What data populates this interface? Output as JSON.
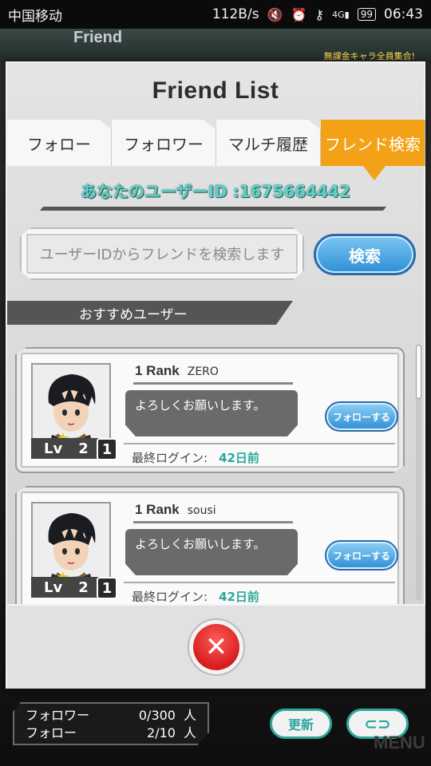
{
  "status_bar": {
    "carrier": "中国移动",
    "net_speed": "112B/s",
    "battery": "99",
    "time": "06:43",
    "signal": "4G"
  },
  "background": {
    "header_title": "Friend",
    "banner": "無課金キャラ全員集合!"
  },
  "modal": {
    "title": "Friend List",
    "tabs": [
      {
        "label": "フォロー",
        "active": false
      },
      {
        "label": "フォロワー",
        "active": false
      },
      {
        "label": "マルチ履歴",
        "active": false
      },
      {
        "label": "フレンド検索",
        "active": true
      }
    ],
    "user_id_text": "あなたのユーザーID :1675664442",
    "search": {
      "placeholder": "ユーザーIDからフレンドを検索します",
      "button_label": "検索"
    },
    "section_title": "おすすめユーザー",
    "users": [
      {
        "rank": "1 Rank",
        "name": "ZERO",
        "message": "よろしくお願いします。",
        "level_label": "Lv",
        "level": "2",
        "tier": "1",
        "follow_label": "フォローする",
        "last_login_label": "最終ログイン:",
        "last_login_value": "42日前"
      },
      {
        "rank": "1 Rank",
        "name": "sousi",
        "message": "よろしくお願いします。",
        "level_label": "Lv",
        "level": "2",
        "tier": "1",
        "follow_label": "フォローする",
        "last_login_label": "最終ログイン:",
        "last_login_value": "42日前"
      }
    ],
    "close_icon": "✕"
  },
  "footer": {
    "follower_label": "フォロワー",
    "follower_count": "0/300",
    "follow_label": "フォロー",
    "follow_count": "2/10",
    "unit": "人",
    "refresh_label": "更新",
    "back_icon": "⊂⊃",
    "menu_label": "MENU"
  },
  "colors": {
    "accent_orange": "#f3a116",
    "teal": "#5ed1c7",
    "button_blue": "#2d8fd6",
    "close_red": "#d61e1e"
  }
}
